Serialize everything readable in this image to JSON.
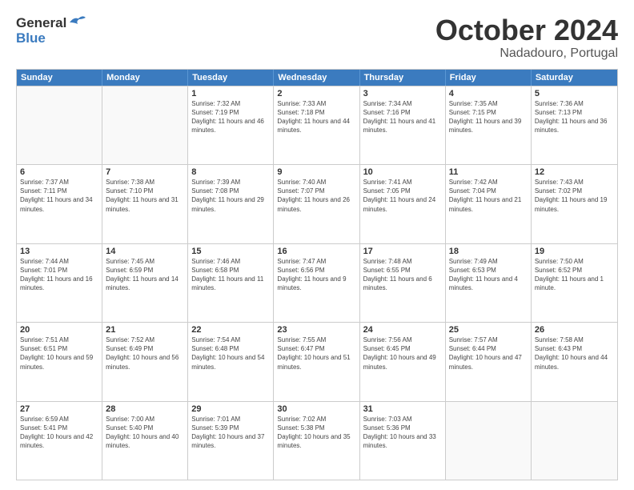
{
  "header": {
    "logo_line1": "General",
    "logo_line2": "Blue",
    "month_year": "October 2024",
    "location": "Nadadouro, Portugal"
  },
  "weekdays": [
    "Sunday",
    "Monday",
    "Tuesday",
    "Wednesday",
    "Thursday",
    "Friday",
    "Saturday"
  ],
  "rows": [
    [
      {
        "day": "",
        "sunrise": "",
        "sunset": "",
        "daylight": ""
      },
      {
        "day": "",
        "sunrise": "",
        "sunset": "",
        "daylight": ""
      },
      {
        "day": "1",
        "sunrise": "Sunrise: 7:32 AM",
        "sunset": "Sunset: 7:19 PM",
        "daylight": "Daylight: 11 hours and 46 minutes."
      },
      {
        "day": "2",
        "sunrise": "Sunrise: 7:33 AM",
        "sunset": "Sunset: 7:18 PM",
        "daylight": "Daylight: 11 hours and 44 minutes."
      },
      {
        "day": "3",
        "sunrise": "Sunrise: 7:34 AM",
        "sunset": "Sunset: 7:16 PM",
        "daylight": "Daylight: 11 hours and 41 minutes."
      },
      {
        "day": "4",
        "sunrise": "Sunrise: 7:35 AM",
        "sunset": "Sunset: 7:15 PM",
        "daylight": "Daylight: 11 hours and 39 minutes."
      },
      {
        "day": "5",
        "sunrise": "Sunrise: 7:36 AM",
        "sunset": "Sunset: 7:13 PM",
        "daylight": "Daylight: 11 hours and 36 minutes."
      }
    ],
    [
      {
        "day": "6",
        "sunrise": "Sunrise: 7:37 AM",
        "sunset": "Sunset: 7:11 PM",
        "daylight": "Daylight: 11 hours and 34 minutes."
      },
      {
        "day": "7",
        "sunrise": "Sunrise: 7:38 AM",
        "sunset": "Sunset: 7:10 PM",
        "daylight": "Daylight: 11 hours and 31 minutes."
      },
      {
        "day": "8",
        "sunrise": "Sunrise: 7:39 AM",
        "sunset": "Sunset: 7:08 PM",
        "daylight": "Daylight: 11 hours and 29 minutes."
      },
      {
        "day": "9",
        "sunrise": "Sunrise: 7:40 AM",
        "sunset": "Sunset: 7:07 PM",
        "daylight": "Daylight: 11 hours and 26 minutes."
      },
      {
        "day": "10",
        "sunrise": "Sunrise: 7:41 AM",
        "sunset": "Sunset: 7:05 PM",
        "daylight": "Daylight: 11 hours and 24 minutes."
      },
      {
        "day": "11",
        "sunrise": "Sunrise: 7:42 AM",
        "sunset": "Sunset: 7:04 PM",
        "daylight": "Daylight: 11 hours and 21 minutes."
      },
      {
        "day": "12",
        "sunrise": "Sunrise: 7:43 AM",
        "sunset": "Sunset: 7:02 PM",
        "daylight": "Daylight: 11 hours and 19 minutes."
      }
    ],
    [
      {
        "day": "13",
        "sunrise": "Sunrise: 7:44 AM",
        "sunset": "Sunset: 7:01 PM",
        "daylight": "Daylight: 11 hours and 16 minutes."
      },
      {
        "day": "14",
        "sunrise": "Sunrise: 7:45 AM",
        "sunset": "Sunset: 6:59 PM",
        "daylight": "Daylight: 11 hours and 14 minutes."
      },
      {
        "day": "15",
        "sunrise": "Sunrise: 7:46 AM",
        "sunset": "Sunset: 6:58 PM",
        "daylight": "Daylight: 11 hours and 11 minutes."
      },
      {
        "day": "16",
        "sunrise": "Sunrise: 7:47 AM",
        "sunset": "Sunset: 6:56 PM",
        "daylight": "Daylight: 11 hours and 9 minutes."
      },
      {
        "day": "17",
        "sunrise": "Sunrise: 7:48 AM",
        "sunset": "Sunset: 6:55 PM",
        "daylight": "Daylight: 11 hours and 6 minutes."
      },
      {
        "day": "18",
        "sunrise": "Sunrise: 7:49 AM",
        "sunset": "Sunset: 6:53 PM",
        "daylight": "Daylight: 11 hours and 4 minutes."
      },
      {
        "day": "19",
        "sunrise": "Sunrise: 7:50 AM",
        "sunset": "Sunset: 6:52 PM",
        "daylight": "Daylight: 11 hours and 1 minute."
      }
    ],
    [
      {
        "day": "20",
        "sunrise": "Sunrise: 7:51 AM",
        "sunset": "Sunset: 6:51 PM",
        "daylight": "Daylight: 10 hours and 59 minutes."
      },
      {
        "day": "21",
        "sunrise": "Sunrise: 7:52 AM",
        "sunset": "Sunset: 6:49 PM",
        "daylight": "Daylight: 10 hours and 56 minutes."
      },
      {
        "day": "22",
        "sunrise": "Sunrise: 7:54 AM",
        "sunset": "Sunset: 6:48 PM",
        "daylight": "Daylight: 10 hours and 54 minutes."
      },
      {
        "day": "23",
        "sunrise": "Sunrise: 7:55 AM",
        "sunset": "Sunset: 6:47 PM",
        "daylight": "Daylight: 10 hours and 51 minutes."
      },
      {
        "day": "24",
        "sunrise": "Sunrise: 7:56 AM",
        "sunset": "Sunset: 6:45 PM",
        "daylight": "Daylight: 10 hours and 49 minutes."
      },
      {
        "day": "25",
        "sunrise": "Sunrise: 7:57 AM",
        "sunset": "Sunset: 6:44 PM",
        "daylight": "Daylight: 10 hours and 47 minutes."
      },
      {
        "day": "26",
        "sunrise": "Sunrise: 7:58 AM",
        "sunset": "Sunset: 6:43 PM",
        "daylight": "Daylight: 10 hours and 44 minutes."
      }
    ],
    [
      {
        "day": "27",
        "sunrise": "Sunrise: 6:59 AM",
        "sunset": "Sunset: 5:41 PM",
        "daylight": "Daylight: 10 hours and 42 minutes."
      },
      {
        "day": "28",
        "sunrise": "Sunrise: 7:00 AM",
        "sunset": "Sunset: 5:40 PM",
        "daylight": "Daylight: 10 hours and 40 minutes."
      },
      {
        "day": "29",
        "sunrise": "Sunrise: 7:01 AM",
        "sunset": "Sunset: 5:39 PM",
        "daylight": "Daylight: 10 hours and 37 minutes."
      },
      {
        "day": "30",
        "sunrise": "Sunrise: 7:02 AM",
        "sunset": "Sunset: 5:38 PM",
        "daylight": "Daylight: 10 hours and 35 minutes."
      },
      {
        "day": "31",
        "sunrise": "Sunrise: 7:03 AM",
        "sunset": "Sunset: 5:36 PM",
        "daylight": "Daylight: 10 hours and 33 minutes."
      },
      {
        "day": "",
        "sunrise": "",
        "sunset": "",
        "daylight": ""
      },
      {
        "day": "",
        "sunrise": "",
        "sunset": "",
        "daylight": ""
      }
    ]
  ]
}
